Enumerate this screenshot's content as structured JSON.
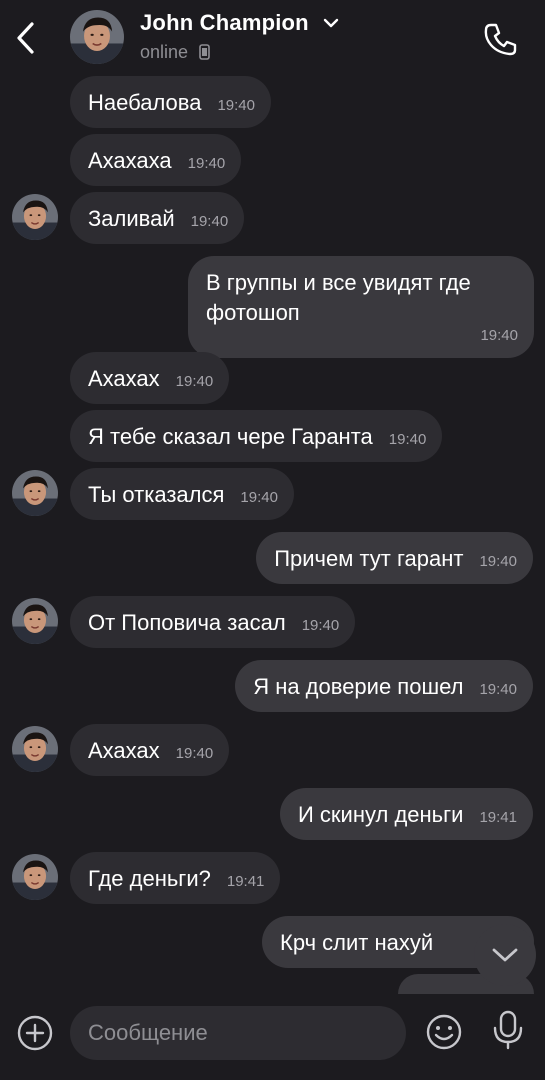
{
  "header": {
    "name": "John Champion",
    "status": "online",
    "icons": {
      "back": "chevron-left-icon",
      "dropdown": "chevron-down-icon",
      "device": "phone-device-icon",
      "call": "phone-call-icon"
    }
  },
  "messages": [
    {
      "text": "Наебалова",
      "time": "19:40",
      "direction": "in"
    },
    {
      "text": "Ахахаха",
      "time": "19:40",
      "direction": "in"
    },
    {
      "text": "Заливай",
      "time": "19:40",
      "direction": "in",
      "avatar": true
    },
    {
      "text_lines": [
        "В группы и все увидят где",
        "фотошоп"
      ],
      "time": "19:40",
      "direction": "out"
    },
    {
      "text": "Ахахах",
      "time": "19:40",
      "direction": "in"
    },
    {
      "text": "Я тебе сказал чере Гаранта",
      "time": "19:40",
      "direction": "in"
    },
    {
      "text": "Ты отказался",
      "time": "19:40",
      "direction": "in",
      "avatar": true
    },
    {
      "text": "Причем тут гарант",
      "time": "19:40",
      "direction": "out"
    },
    {
      "text": "От Поповича засал",
      "time": "19:40",
      "direction": "in",
      "avatar": true
    },
    {
      "text": "Я на доверие пошел",
      "time": "19:40",
      "direction": "out"
    },
    {
      "text": "Ахахах",
      "time": "19:40",
      "direction": "in",
      "avatar": true
    },
    {
      "text": "И скинул деньги",
      "time": "19:41",
      "direction": "out"
    },
    {
      "text": "Где деньги?",
      "time": "19:41",
      "direction": "in",
      "avatar": true
    },
    {
      "text": "Крч слит нахуй",
      "time": "",
      "direction": "out"
    }
  ],
  "input": {
    "placeholder": "Сообщение",
    "icons": {
      "attach": "plus-circle-icon",
      "emoji": "emoji-icon",
      "mic": "microphone-icon",
      "scroll": "chevron-down-icon"
    }
  },
  "colors": {
    "background": "#1c1b1f",
    "incoming_bubble": "#2d2c31",
    "outgoing_bubble": "#3a393e",
    "secondary_text": "#8e8e93"
  }
}
